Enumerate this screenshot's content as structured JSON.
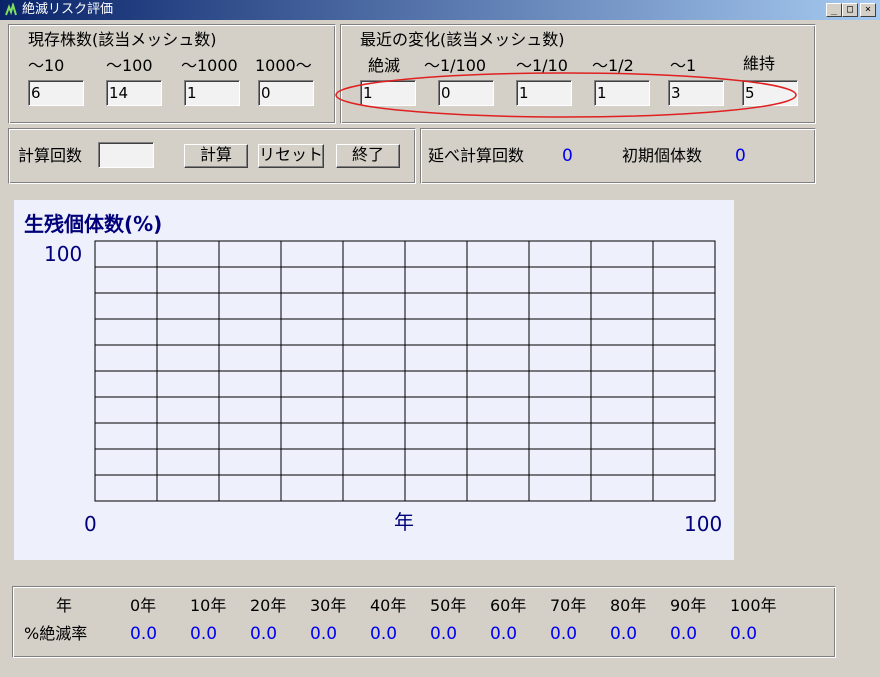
{
  "window": {
    "title": "絶滅リスク評価",
    "btn_minimize": "_",
    "btn_maximize": "□",
    "btn_close": "×"
  },
  "current_stock": {
    "title": "現存株数(該当メッシュ数)",
    "labels": [
      "～10",
      "～100",
      "～1000",
      "1000～"
    ],
    "values": [
      "6",
      "14",
      "1",
      "0"
    ]
  },
  "recent_change": {
    "title": "最近の変化(該当メッシュ数)",
    "labels": [
      "絶滅",
      "～1/100",
      "～1/10",
      "～1/2",
      "～1",
      "維持"
    ],
    "values": [
      "1",
      "0",
      "1",
      "1",
      "3",
      "5"
    ]
  },
  "controls": {
    "calc_count_label": "計算回数",
    "calc_count_value": "",
    "calc_button": "計算",
    "reset_button": "リセット",
    "exit_button": "終了"
  },
  "summary": {
    "total_calc_label": "延べ計算回数",
    "total_calc_value": "0",
    "initial_pop_label": "初期個体数",
    "initial_pop_value": "0"
  },
  "chart_data": {
    "type": "line",
    "title": "生残個体数(%)",
    "ylabel_top": "100",
    "x_start": "0",
    "x_mid": "年",
    "x_end": "100",
    "xlim": [
      0,
      100
    ],
    "ylim": [
      0,
      100
    ],
    "grid": true,
    "grid_cols": 10,
    "grid_rows": 10,
    "series": []
  },
  "table": {
    "year_label": "年",
    "rate_label": "%絶滅率",
    "years": [
      "0年",
      "10年",
      "20年",
      "30年",
      "40年",
      "50年",
      "60年",
      "70年",
      "80年",
      "90年",
      "100年"
    ],
    "rates": [
      "0.0",
      "0.0",
      "0.0",
      "0.0",
      "0.0",
      "0.0",
      "0.0",
      "0.0",
      "0.0",
      "0.0",
      "0.0"
    ]
  },
  "colors": {
    "titlebar_start": "#0a246a",
    "titlebar_end": "#a6caf0",
    "value_blue": "#0000ee",
    "chart_bg": "#eef0fc",
    "highlight_ellipse": "#e02020"
  }
}
